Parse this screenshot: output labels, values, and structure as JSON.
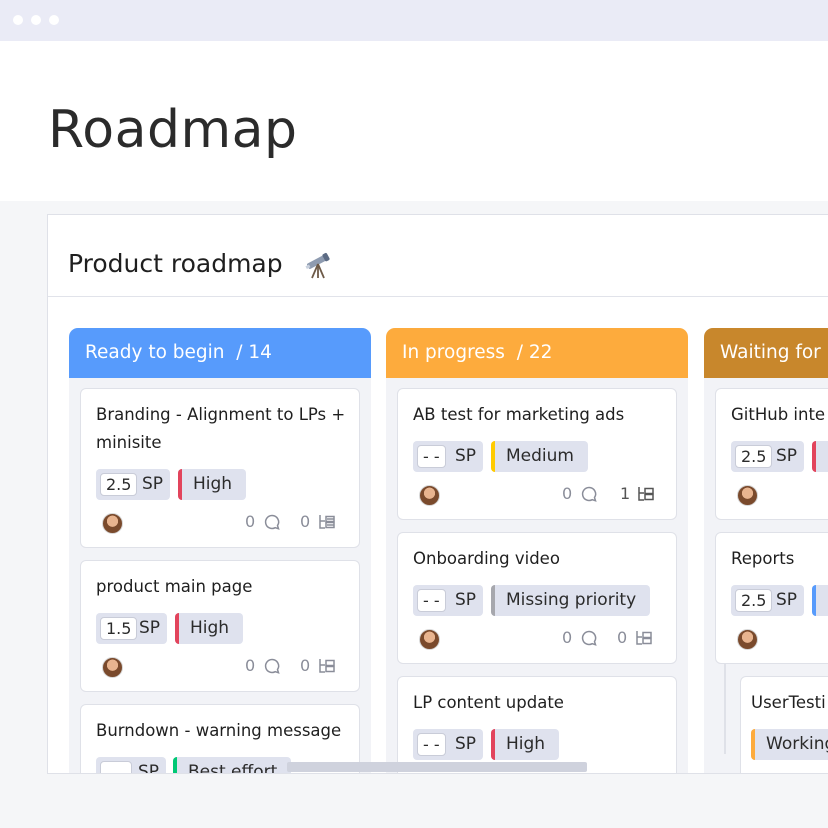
{
  "page": {
    "title": "Roadmap"
  },
  "board": {
    "title": "Product roadmap"
  },
  "colors": {
    "ready": "#579bfc",
    "in_progress": "#fdab3d",
    "waiting": "#c8872c",
    "priority_high": "#e2445c",
    "priority_medium": "#ffcb00",
    "priority_missing": "#a6a7ad",
    "priority_best_effort": "#00c875"
  },
  "columns": [
    {
      "title": "Ready to begin",
      "count": "/ 14",
      "cards": [
        {
          "title": "Branding  - Alignment to LPs + minisite",
          "sp": "2.5",
          "sp_unit": "SP",
          "priority": "High",
          "comments": "0",
          "subitems": "0"
        },
        {
          "title": "product main page",
          "sp": "1.5",
          "sp_unit": "SP",
          "priority": "High",
          "comments": "0",
          "subitems": "0"
        },
        {
          "title": "Burndown - warning message",
          "sp": "",
          "sp_unit": "SP",
          "priority": "Best effort"
        }
      ]
    },
    {
      "title": "In progress",
      "count": "/ 22",
      "cards": [
        {
          "title": "AB test for marketing ads",
          "sp": "- -",
          "sp_unit": "SP",
          "priority": "Medium",
          "comments": "0",
          "subitems": "1"
        },
        {
          "title": "Onboarding video",
          "sp": "- -",
          "sp_unit": "SP",
          "priority": "Missing priority",
          "comments": "0",
          "subitems": "0"
        },
        {
          "title": "LP content update",
          "sp": "- -",
          "sp_unit": "SP",
          "priority": "High"
        }
      ]
    },
    {
      "title": "Waiting for",
      "cards": [
        {
          "title": "GitHub inte",
          "sp": "2.5",
          "sp_unit": "SP"
        },
        {
          "title": "Reports",
          "sp": "2.5",
          "sp_unit": "SP"
        },
        {
          "title": "UserTesti",
          "status": "Working"
        }
      ]
    }
  ]
}
